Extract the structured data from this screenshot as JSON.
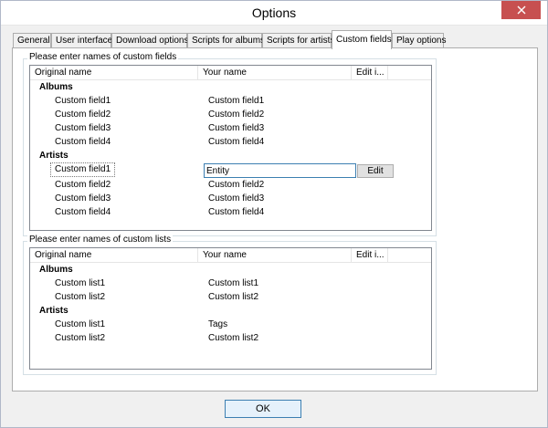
{
  "window": {
    "title": "Options",
    "close_glyph": "close-icon"
  },
  "tabs": [
    {
      "label": "General"
    },
    {
      "label": "User interface"
    },
    {
      "label": "Download options"
    },
    {
      "label": "Scripts for albums"
    },
    {
      "label": "Scripts for artists"
    },
    {
      "label": "Custom fields"
    },
    {
      "label": "Play options"
    }
  ],
  "active_tab": "Custom fields",
  "fields": {
    "legend": "Please enter names of custom fields",
    "headers": {
      "original": "Original name",
      "yours": "Your name",
      "edit": "Edit i..."
    },
    "albums_title": "Albums",
    "albums": [
      {
        "original": "Custom field1",
        "yours": "Custom field1"
      },
      {
        "original": "Custom field2",
        "yours": "Custom field2"
      },
      {
        "original": "Custom field3",
        "yours": "Custom field3"
      },
      {
        "original": "Custom field4",
        "yours": "Custom field4"
      }
    ],
    "artists_title": "Artists",
    "artists": [
      {
        "original": "Custom field1",
        "yours": "Entity",
        "edit_label": "Edit"
      },
      {
        "original": "Custom field2",
        "yours": "Custom field2"
      },
      {
        "original": "Custom field3",
        "yours": "Custom field3"
      },
      {
        "original": "Custom field4",
        "yours": "Custom field4"
      }
    ]
  },
  "lists": {
    "legend": "Please enter names of custom lists",
    "headers": {
      "original": "Original name",
      "yours": "Your name",
      "edit": "Edit i..."
    },
    "albums_title": "Albums",
    "albums": [
      {
        "original": "Custom list1",
        "yours": "Custom list1"
      },
      {
        "original": "Custom list2",
        "yours": "Custom list2"
      }
    ],
    "artists_title": "Artists",
    "artists": [
      {
        "original": "Custom list1",
        "yours": "Tags"
      },
      {
        "original": "Custom list2",
        "yours": "Custom list2"
      }
    ]
  },
  "ok_label": "OK"
}
